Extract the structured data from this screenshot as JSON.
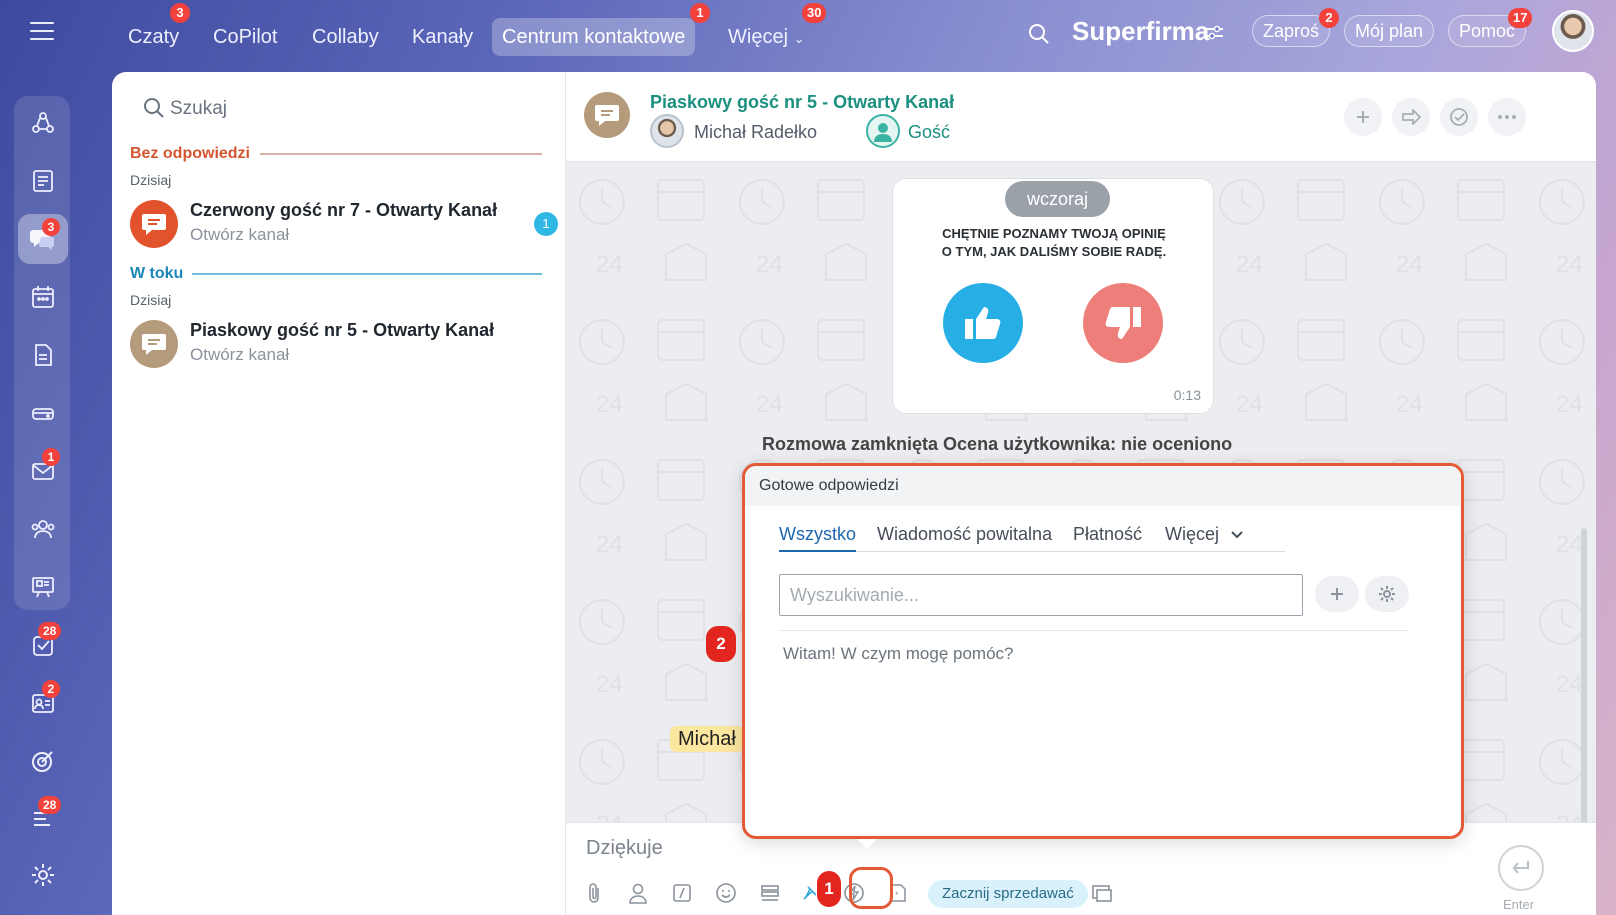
{
  "topnav": {
    "items": [
      {
        "label": "Czaty",
        "badge": "3"
      },
      {
        "label": "CoPilot",
        "badge": ""
      },
      {
        "label": "Collaby",
        "badge": ""
      },
      {
        "label": "Kanały",
        "badge": ""
      },
      {
        "label": "Centrum kontaktowe",
        "badge": "1"
      },
      {
        "label": "Więcej",
        "badge": "30"
      }
    ],
    "brand": "Superfirma",
    "invite": {
      "label": "Zaproś",
      "badge": "2"
    },
    "plan": "Mój plan",
    "help": {
      "label": "Pomoc",
      "badge": "17"
    }
  },
  "sidebar_badges": {
    "chats": "3",
    "mail": "1",
    "tasks": "28",
    "crm": "2",
    "feed": "28"
  },
  "left": {
    "search_placeholder": "Szukaj",
    "section_unanswered": "Bez odpowiedzi",
    "section_in_progress": "W toku",
    "today": "Dzisiaj",
    "chats": [
      {
        "title": "Czerwony gość nr 7 - Otwarty Kanał",
        "subtitle": "Otwórz kanał",
        "count": "1"
      },
      {
        "title": "Piaskowy gość nr 5 - Otwarty Kanał",
        "subtitle": "Otwórz kanał",
        "count": ""
      }
    ]
  },
  "chat": {
    "title": "Piaskowy gość nr 5 - Otwarty Kanał",
    "user_name": "Michał Radełko",
    "guest": "Gość",
    "date_pill": "wczoraj",
    "rating_text_line1": "CHĘTNIE POZNAMY TWOJĄ OPINIĘ",
    "rating_text_line2": "O TYM, JAK DALIŚMY SOBIE RADĘ.",
    "rating_time": "0:13",
    "closed_text": "Rozmowa zamknięta      Ocena użytkownika: nie oceniono",
    "sender_chip": "Michał",
    "composer_text": "Dziękuje",
    "sell_chip": "Zacznij sprzedawać",
    "send_label": "Enter"
  },
  "popup": {
    "title": "Gotowe odpowiedzi",
    "tabs": [
      "Wszystko",
      "Wiadomość powitalna",
      "Płatność",
      "Więcej"
    ],
    "search_placeholder": "Wyszukiwanie...",
    "items": [
      "Witam! W czym mogę pomóc?"
    ]
  },
  "steps": {
    "one": "1",
    "two": "2"
  },
  "colors": {
    "accent": "#e45a34",
    "teal": "#1b8f80",
    "blue": "#2067b0",
    "badge": "#f2423b"
  }
}
